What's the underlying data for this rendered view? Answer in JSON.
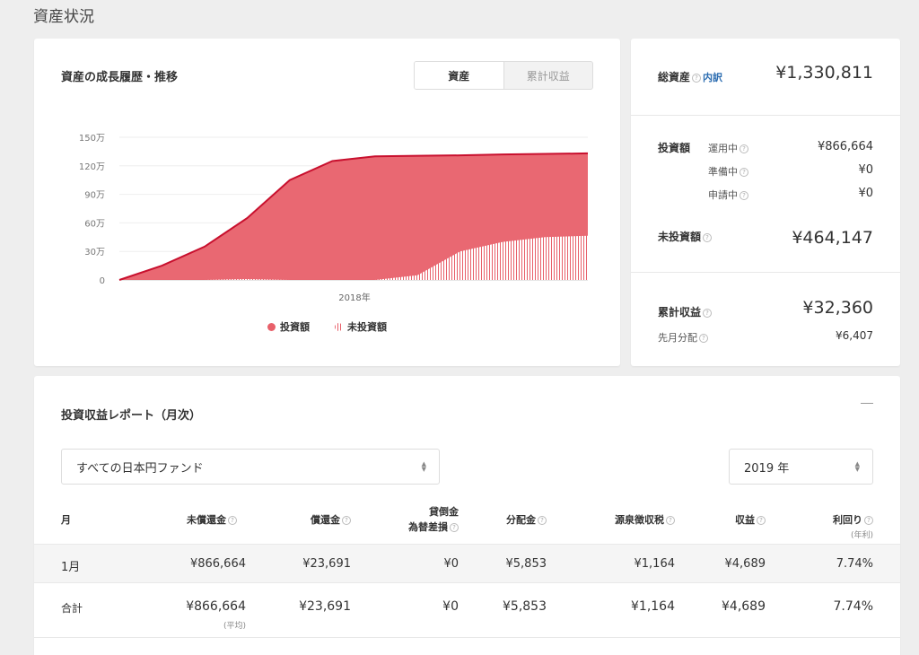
{
  "page_title": "資産状況",
  "chart_card": {
    "title": "資産の成長履歴・推移",
    "tabs": [
      {
        "label": "資産"
      },
      {
        "label": "累計収益"
      }
    ],
    "legend": [
      {
        "label": "投資額"
      },
      {
        "label": "未投資額"
      }
    ]
  },
  "chart_data": {
    "type": "area",
    "x_label": "2018年",
    "y_ticks": [
      "0",
      "30万",
      "60万",
      "90万",
      "120万",
      "150万"
    ],
    "ylim": [
      0,
      1500000
    ],
    "series": [
      {
        "name": "投資額",
        "values": [
          0,
          150000,
          350000,
          650000,
          1050000,
          1250000,
          1300000,
          1305000,
          1310000,
          1320000,
          1325000,
          1330811
        ]
      },
      {
        "name": "未投資額",
        "values": [
          0,
          0,
          0,
          10000,
          0,
          0,
          0,
          50000,
          300000,
          400000,
          450000,
          464147
        ]
      }
    ],
    "colors": {
      "invested": "#e8606a",
      "line": "#c8102e"
    }
  },
  "summary": {
    "total_label": "総資産",
    "breakdown_link": "内訳",
    "total_value": "¥1,330,811",
    "invested_label": "投資額",
    "invested_rows": [
      {
        "label": "運用中",
        "value": "¥866,664"
      },
      {
        "label": "準備中",
        "value": "¥0"
      },
      {
        "label": "申請中",
        "value": "¥0"
      }
    ],
    "uninvested_label": "未投資額",
    "uninvested_value": "¥464,147",
    "cumulative_label": "累計収益",
    "cumulative_value": "¥32,360",
    "last_month_label": "先月分配",
    "last_month_value": "¥6,407"
  },
  "report": {
    "title": "投資収益レポート（月次）",
    "fund_select": "すべての日本円ファンド",
    "year_select": "2019 年",
    "columns": {
      "month": "月",
      "outstanding": "未償還金",
      "redemption": "償還金",
      "bad_debt_1": "貸倒金",
      "bad_debt_2": "為替差損",
      "distribution": "分配金",
      "withholding": "源泉徴収税",
      "profit": "収益",
      "yield": "利回り",
      "yield_note": "(年利)"
    },
    "rows": [
      {
        "month": "1月",
        "outstanding": "¥866,664",
        "redemption": "¥23,691",
        "bad_debt": "¥0",
        "distribution": "¥5,853",
        "withholding": "¥1,164",
        "profit": "¥4,689",
        "yield": "7.74%"
      }
    ],
    "total": {
      "month": "合計",
      "outstanding": "¥866,664",
      "outstanding_note": "(平均)",
      "redemption": "¥23,691",
      "bad_debt": "¥0",
      "distribution": "¥5,853",
      "withholding": "¥1,164",
      "profit": "¥4,689",
      "yield": "7.74%"
    }
  }
}
